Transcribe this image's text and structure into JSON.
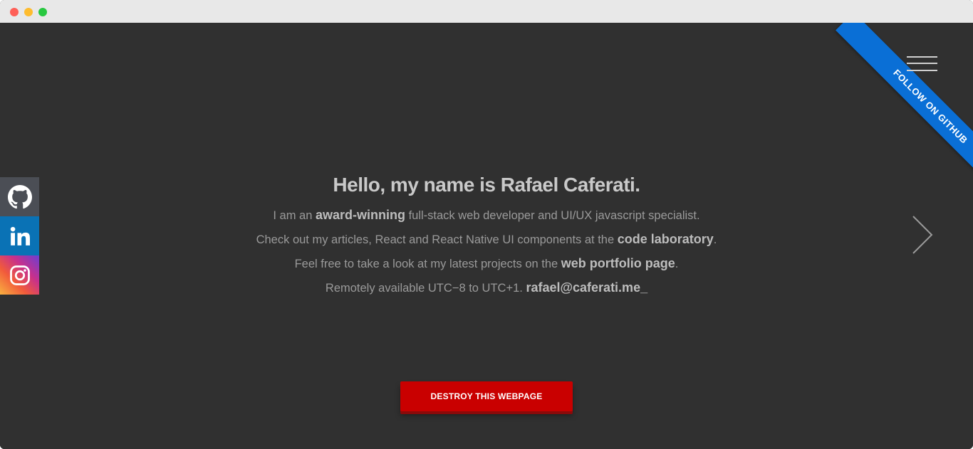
{
  "window": {
    "controls": [
      "close",
      "minimize",
      "maximize"
    ]
  },
  "ribbon": {
    "label": "Follow on GitHub",
    "color": "#0a6fd6"
  },
  "menu": {
    "icon": "hamburger-menu-icon"
  },
  "social": [
    {
      "name": "github",
      "icon": "github-icon",
      "color": "#4b4e55"
    },
    {
      "name": "linkedin",
      "icon": "linkedin-icon",
      "color": "#0a72b5"
    },
    {
      "name": "instagram",
      "icon": "instagram-icon",
      "color": "#c7308c"
    }
  ],
  "intro": {
    "headline": "Hello, my name is Rafael Caferati.",
    "line1": {
      "pre": "I am an ",
      "strong": "award-winning",
      "post": " full-stack web developer and UI/UX javascript specialist."
    },
    "line2": {
      "pre": "Check out my articles, React and React Native UI components at the ",
      "strong": "code laboratory",
      "post": "."
    },
    "line3": {
      "pre": "Feel free to take a look at my latest projects on the ",
      "strong": "web portfolio page",
      "post": "."
    },
    "line4": {
      "pre": "Remotely available UTC−8 to UTC+1. ",
      "strong": "rafael@caferati.me_",
      "post": ""
    }
  },
  "navigation": {
    "next_icon": "chevron-right-icon"
  },
  "actions": {
    "destroy_label": "Destroy this webpage",
    "destroy_color": "#c90000"
  }
}
